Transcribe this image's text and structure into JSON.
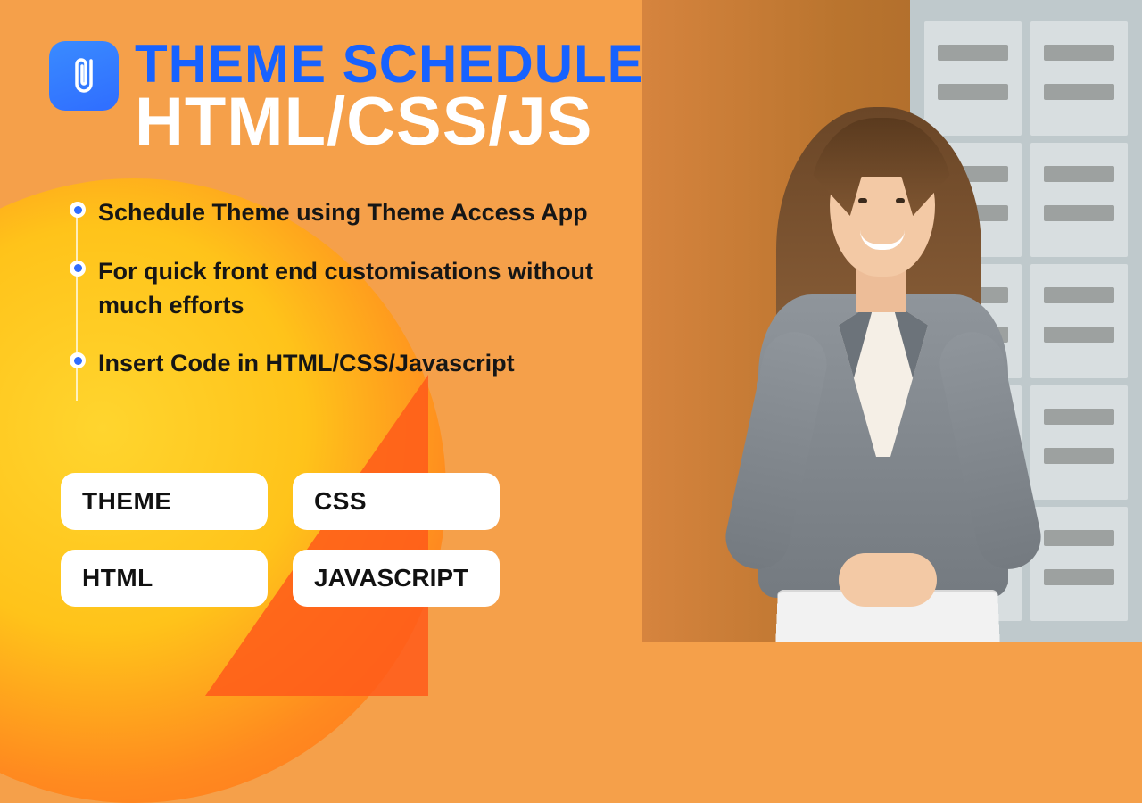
{
  "header": {
    "title_line1": "THEME SCHEDULE",
    "title_line2": "HTML/CSS/JS"
  },
  "bullets": [
    "Schedule Theme using Theme Access App",
    "For quick front end customisations without much efforts",
    "Insert Code in HTML/CSS/Javascript"
  ],
  "tags": [
    "THEME",
    "CSS",
    "HTML",
    "JAVASCRIPT"
  ]
}
